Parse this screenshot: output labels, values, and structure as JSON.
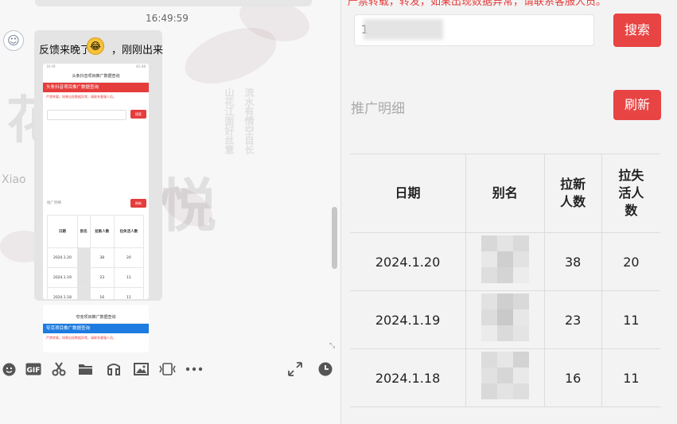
{
  "chat": {
    "timestamp": "16:49:59",
    "message_text_before": "反馈来晚了",
    "message_text_after": "，刚刚出来",
    "emoji_icon": "laughing-face",
    "bg_watermark": "Xiao"
  },
  "phone_screenshot_1": {
    "status_left": "16:49",
    "status_right": "4G 88",
    "nav_title": "头条抖音项目推广数据查询",
    "banner": "头条抖音项目推广数据查询",
    "note": "严禁转载。如果出现数据异常，请联系客服人员。",
    "search_button": "搜索",
    "section_label": "推广明细",
    "refresh_button": "刷新",
    "headers": [
      "日期",
      "别名",
      "拉新人数",
      "拉失活人数"
    ],
    "rows": [
      {
        "date": "2024.1.20",
        "new": "38",
        "lost": "20"
      },
      {
        "date": "2024.1.19",
        "new": "23",
        "lost": "11"
      },
      {
        "date": "2024.1.18",
        "new": "16",
        "lost": "11"
      }
    ],
    "accent_color": "#e53c3c"
  },
  "phone_screenshot_2": {
    "nav_title": "夸克项目推广数据查询",
    "banner": "夸克项目推广数据查询",
    "note": "严禁转载。如果出现数据异常，请联系客服人员。",
    "accent_color": "#1e7be0"
  },
  "toolbar": {
    "icons": [
      "emoji-icon",
      "gif-icon",
      "scissors-icon",
      "folder-icon",
      "music-icon",
      "image-icon",
      "screenshot-icon",
      "more-icon",
      "expand-icon",
      "history-icon"
    ]
  },
  "right": {
    "top_note": "严禁转载，转发，如果出现数据异常，请联系客服人员。",
    "search_value": "1",
    "search_button": "搜索",
    "section_title": "推广明细",
    "refresh_button": "刷新",
    "headers": {
      "date": "日期",
      "alias": "别名",
      "new": "拉新\n人数",
      "lost": "拉失\n活人\n数"
    },
    "rows": [
      {
        "date": "2024.1.20",
        "new": "38",
        "lost": "20"
      },
      {
        "date": "2024.1.19",
        "new": "23",
        "lost": "11"
      },
      {
        "date": "2024.1.18",
        "new": "16",
        "lost": "11"
      }
    ],
    "accent_color": "#e84444"
  }
}
